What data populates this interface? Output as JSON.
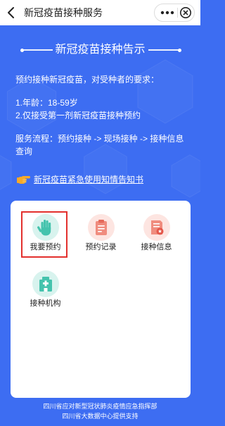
{
  "header": {
    "title": "新冠疫苗接种服务",
    "back_icon": "chevron-left-icon",
    "more_icon": "more-dots-icon",
    "close_icon": "close-circle-icon"
  },
  "notice": {
    "title": "新冠疫苗接种告示",
    "intro": "预约接种新冠疫苗，对受种者的要求：",
    "requirements": [
      "1.年龄：18-59岁",
      "2.仅接受第一剂新冠疫苗接种预约"
    ],
    "process_lines": [
      "服务流程：预约接种 -> 现场接种 -> 接种信息",
      "查询"
    ]
  },
  "consent_link": {
    "icon": "pointing-hand-icon",
    "label": "新冠疫苗紧急使用知情告知书"
  },
  "services": [
    {
      "label": "我要预约",
      "icon": "raised-hand-icon",
      "highlighted": true
    },
    {
      "label": "预约记录",
      "icon": "clipboard-icon",
      "highlighted": false
    },
    {
      "label": "接种信息",
      "icon": "certificate-icon",
      "highlighted": false
    },
    {
      "label": "接种机构",
      "icon": "hospital-icon",
      "highlighted": false
    }
  ],
  "footer": {
    "lines": [
      "四川省应对新型冠状肺炎疫情应急指挥部",
      "四川省大数据中心提供支持"
    ]
  },
  "colors": {
    "background": "#3d6df2",
    "highlight_border": "#e3302d",
    "teal_icon": "#45c3ad",
    "pink_icon": "#f08c7e",
    "link_icon": "#f7a928"
  }
}
